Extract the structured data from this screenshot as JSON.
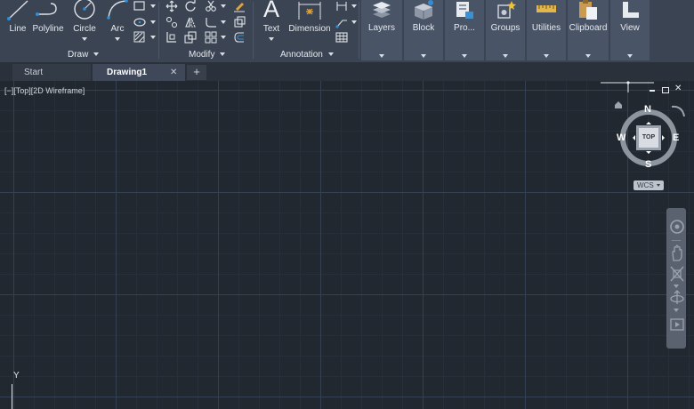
{
  "ribbon": {
    "draw": {
      "title": "Draw",
      "line": "Line",
      "polyline": "Polyline",
      "circle": "Circle",
      "arc": "Arc"
    },
    "modify": {
      "title": "Modify"
    },
    "annotation": {
      "title": "Annotation",
      "text": "Text",
      "dimension": "Dimension"
    },
    "panels": [
      {
        "label": "Layers"
      },
      {
        "label": "Block"
      },
      {
        "label": "Pro..."
      },
      {
        "label": "Groups"
      },
      {
        "label": "Utilities"
      },
      {
        "label": "Clipboard"
      },
      {
        "label": "View"
      }
    ]
  },
  "tabs": {
    "start": "Start",
    "drawing1": "Drawing1",
    "close_glyph": "✕",
    "add_glyph": "+"
  },
  "viewport": {
    "label": "[−][Top][2D Wireframe]",
    "close_glyph": "✕"
  },
  "viewcube": {
    "north": "N",
    "south": "S",
    "east": "E",
    "west": "W",
    "top": "TOP",
    "wcs": "WCS"
  },
  "ucs": {
    "y_label": "Y"
  },
  "colors": {
    "ribbon_bg": "#3b4453",
    "canvas_bg": "#212830",
    "accent": "#2f8fd8"
  }
}
